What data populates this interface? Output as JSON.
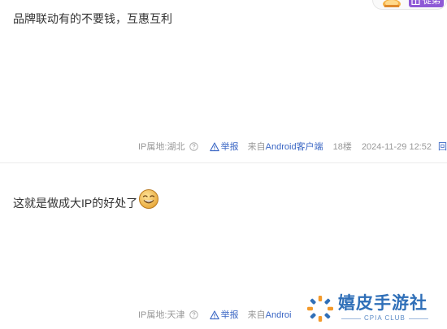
{
  "badge": {
    "label": "徒弟",
    "accent_color": "#8e59d6",
    "icon": "gift-icon"
  },
  "posts": [
    {
      "content": "品牌联动有的不要钱，互惠互利",
      "ip_location": "IP属地:湖北",
      "report_label": "举报",
      "source_prefix": "来自",
      "source_device": "Android客户端",
      "floor": "18楼",
      "time": "2024-11-29 12:52",
      "reply_label": "回复"
    },
    {
      "content": "这就是做成大IP的好处了",
      "emoji": "smiley-emoji-icon",
      "ip_location": "IP属地:天津",
      "report_label": "举报",
      "source_prefix": "来自",
      "source_device": "Androi"
    }
  ],
  "watermark": {
    "name": "嬉皮手游社",
    "subtitle": "CPIA CLUB",
    "color": "#2f6fb8"
  },
  "colors": {
    "link": "#3a66c4",
    "meta_text": "#999999",
    "body_text": "#333333"
  }
}
